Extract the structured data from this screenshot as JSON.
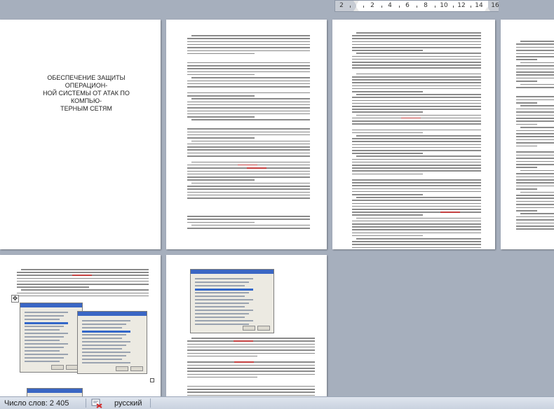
{
  "ruler": {
    "labels": [
      "2",
      "2",
      "4",
      "6",
      "8",
      "10",
      "12",
      "14",
      "16"
    ]
  },
  "document": {
    "title_lines": [
      "ОБЕСПЕЧЕНИЕ ЗАЩИТЫ ОПЕРАЦИОН-",
      "НОЙ СИСТЕМЫ ОТ АТАК ПО КОМПЬЮ-",
      "ТЕРНЫМ СЕТЯМ"
    ]
  },
  "statusbar": {
    "word_count": "Число слов: 2 405",
    "language": "русский"
  },
  "colors": {
    "workspace": "#a6afbd",
    "highlight_red": "#c24040",
    "highlight_green": "#3f8f3f"
  }
}
